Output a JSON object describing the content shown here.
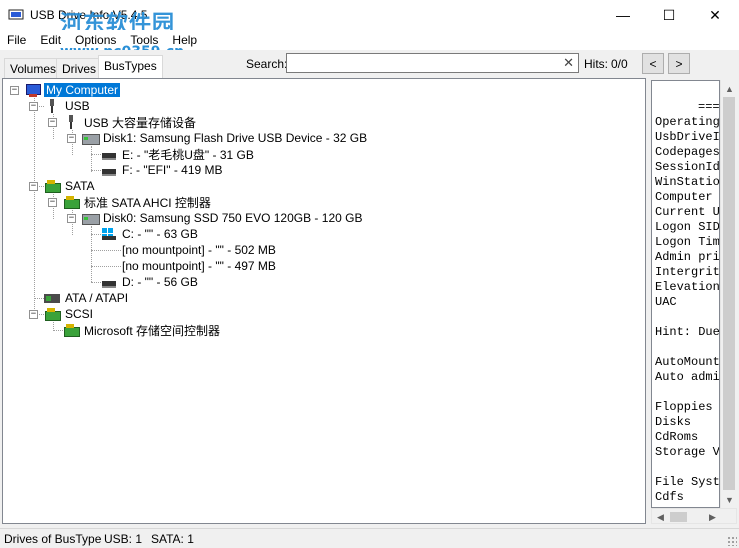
{
  "window": {
    "title": "USB Drive Info V5.4.5",
    "watermark_text": "河东软件园",
    "watermark_url": "www.pc0359.cn",
    "minimize_glyph": "—",
    "maximize_glyph": "☐",
    "close_glyph": "✕"
  },
  "menu": [
    "File",
    "Edit",
    "Options",
    "Tools",
    "Help"
  ],
  "tabs": [
    {
      "label": "Volumes",
      "active": false
    },
    {
      "label": "Drives",
      "active": false
    },
    {
      "label": "BusTypes",
      "active": true
    }
  ],
  "search": {
    "label": "Search:",
    "value": "",
    "clear_glyph": "✕",
    "hits_label": "Hits:",
    "hits_value": "0/0",
    "prev_glyph": "<",
    "next_glyph": ">"
  },
  "tree": {
    "root": "My Computer",
    "usb_bus": "USB",
    "usb_controller": "USB 大容量存储设备",
    "usb_disk": "Disk1: Samsung Flash Drive USB Device - 32 GB",
    "usb_vol_e": "E: - \"老毛桃U盘\" - 31 GB",
    "usb_vol_f": "F: - \"EFI\" - 419 MB",
    "sata_bus": "SATA",
    "sata_controller": "标准 SATA AHCI 控制器",
    "sata_disk": "Disk0: Samsung SSD 750 EVO 120GB - 120 GB",
    "sata_vol_c": "C: - \"\" - 63 GB",
    "sata_vol_nm1": "[no mountpoint] - \"\" - 502 MB",
    "sata_vol_nm2": "[no mountpoint] - \"\" - 497 MB",
    "sata_vol_d": "D: - \"\" - 56 GB",
    "ata_bus": "ATA / ATAPI",
    "scsi_bus": "SCSI",
    "scsi_controller": "Microsoft 存储空间控制器"
  },
  "info_panel": {
    "lines": [
      "===",
      "Operating",
      "UsbDriveI",
      "Codepages",
      "SessionId",
      "WinStatio",
      "Computer",
      "Current U",
      "Logon SID",
      "Logon Tim",
      "Admin pri",
      "Intergrit",
      "Elevation",
      "UAC",
      "",
      "Hint: Due",
      "",
      "AutoMount",
      "Auto admi",
      "",
      "Floppies",
      "Disks",
      "CdRoms",
      "Storage V",
      "",
      "File Syst",
      "Cdfs"
    ]
  },
  "status": {
    "left": "Drives of BusType",
    "usb": "USB: 1",
    "sata": "SATA: 1"
  }
}
